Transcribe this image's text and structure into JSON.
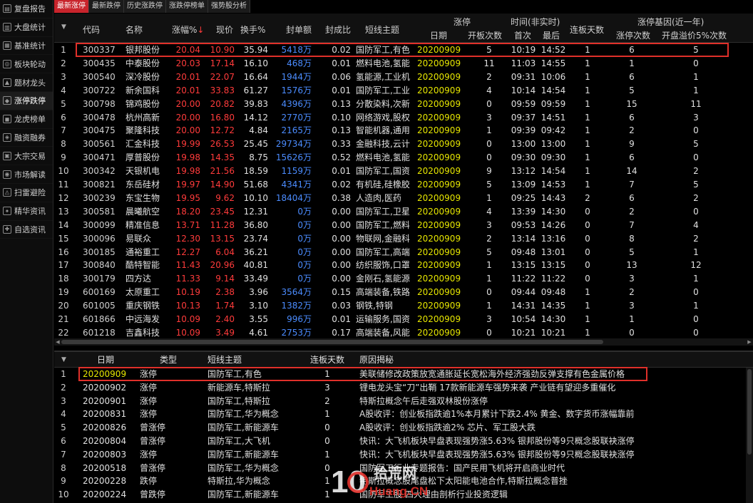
{
  "sidebar": {
    "items": [
      {
        "label": "复盘报告",
        "icon": "report-icon"
      },
      {
        "label": "大盘统计",
        "icon": "market-icon"
      },
      {
        "label": "基准统计",
        "icon": "stats-icon"
      },
      {
        "label": "板块轮动",
        "icon": "rotate-icon"
      },
      {
        "label": "题材龙头",
        "icon": "dragon-icon"
      },
      {
        "label": "涨停跌停",
        "icon": "limit-icon"
      },
      {
        "label": "龙虎榜单",
        "icon": "list-icon"
      },
      {
        "label": "融资融券",
        "icon": "finance-icon"
      },
      {
        "label": "大宗交易",
        "icon": "block-trade-icon"
      },
      {
        "label": "市场解读",
        "icon": "read-icon"
      },
      {
        "label": "扫雷避险",
        "icon": "mine-icon"
      },
      {
        "label": "精华资讯",
        "icon": "news-icon"
      },
      {
        "label": "自选资讯",
        "icon": "star-icon"
      }
    ],
    "active_index": 5
  },
  "tabs": [
    {
      "label": "最新涨停",
      "active": true
    },
    {
      "label": "最新跌停",
      "active": false
    },
    {
      "label": "历史涨跌停",
      "active": false
    },
    {
      "label": "涨跌停榜单",
      "active": false
    },
    {
      "label": "强势股分析",
      "active": false
    }
  ],
  "main_header": {
    "code": "代码",
    "name": "名称",
    "pct": "涨幅%",
    "price": "现价",
    "turnover": "换手%",
    "seal": "封单额",
    "seal_ratio": "封成比",
    "theme": "短线主题",
    "limit_group": "涨停",
    "date": "日期",
    "open_count": "开板次数",
    "time_group": "时间(非实时)",
    "first": "首次",
    "last": "最后",
    "streak": "连板天数",
    "gene_group": "涨停基因(近一年)",
    "zt_count": "涨停次数",
    "premium_count": "开盘溢价5%次数"
  },
  "main_rows": [
    {
      "no": "1",
      "code": "300337",
      "name": "银邦股份",
      "pct": "20.04",
      "price": "10.90",
      "turn": "35.94",
      "seal": "5418万",
      "ratio": "0.02",
      "theme": "国防军工,有色",
      "date": "20200909",
      "open": "5",
      "first": "10:19",
      "last": "14:52",
      "streak": "1",
      "zt": "6",
      "prem": "5"
    },
    {
      "no": "2",
      "code": "300435",
      "name": "中泰股份",
      "pct": "20.03",
      "price": "17.14",
      "turn": "16.10",
      "seal": "468万",
      "ratio": "0.01",
      "theme": "燃料电池,氢能",
      "date": "20200909",
      "open": "11",
      "first": "11:03",
      "last": "14:55",
      "streak": "1",
      "zt": "1",
      "prem": "0"
    },
    {
      "no": "3",
      "code": "300540",
      "name": "深冷股份",
      "pct": "20.01",
      "price": "22.07",
      "turn": "16.64",
      "seal": "1944万",
      "ratio": "0.06",
      "theme": "氢能源,工业机",
      "date": "20200909",
      "open": "2",
      "first": "09:31",
      "last": "10:06",
      "streak": "1",
      "zt": "6",
      "prem": "1"
    },
    {
      "no": "4",
      "code": "300722",
      "name": "新余国科",
      "pct": "20.01",
      "price": "33.83",
      "turn": "61.27",
      "seal": "1576万",
      "ratio": "0.01",
      "theme": "国防军工,工业",
      "date": "20200909",
      "open": "4",
      "first": "10:14",
      "last": "14:54",
      "streak": "1",
      "zt": "5",
      "prem": "1"
    },
    {
      "no": "5",
      "code": "300798",
      "name": "锦鸡股份",
      "pct": "20.00",
      "price": "20.82",
      "turn": "39.83",
      "seal": "4396万",
      "ratio": "0.13",
      "theme": "分散染料,次新",
      "date": "20200909",
      "open": "0",
      "first": "09:59",
      "last": "09:59",
      "streak": "1",
      "zt": "15",
      "prem": "11"
    },
    {
      "no": "6",
      "code": "300478",
      "name": "杭州高新",
      "pct": "20.00",
      "price": "16.80",
      "turn": "14.12",
      "seal": "2770万",
      "ratio": "0.10",
      "theme": "网络游戏,股权",
      "date": "20200909",
      "open": "3",
      "first": "09:37",
      "last": "14:51",
      "streak": "1",
      "zt": "6",
      "prem": "3"
    },
    {
      "no": "7",
      "code": "300475",
      "name": "聚隆科技",
      "pct": "20.00",
      "price": "12.72",
      "turn": "4.84",
      "seal": "2165万",
      "ratio": "0.13",
      "theme": "智能机器,通用",
      "date": "20200909",
      "open": "1",
      "first": "09:39",
      "last": "09:42",
      "streak": "1",
      "zt": "2",
      "prem": "0"
    },
    {
      "no": "8",
      "code": "300561",
      "name": "汇金科技",
      "pct": "19.99",
      "price": "26.53",
      "turn": "25.45",
      "seal": "29734万",
      "ratio": "0.33",
      "theme": "金融科技,云计",
      "date": "20200909",
      "open": "0",
      "first": "13:00",
      "last": "13:00",
      "streak": "1",
      "zt": "9",
      "prem": "5"
    },
    {
      "no": "9",
      "code": "300471",
      "name": "厚普股份",
      "pct": "19.98",
      "price": "14.35",
      "turn": "8.75",
      "seal": "15626万",
      "ratio": "0.52",
      "theme": "燃料电池,氢能",
      "date": "20200909",
      "open": "0",
      "first": "09:30",
      "last": "09:30",
      "streak": "1",
      "zt": "6",
      "prem": "0"
    },
    {
      "no": "10",
      "code": "300342",
      "name": "天银机电",
      "pct": "19.98",
      "price": "21.56",
      "turn": "18.59",
      "seal": "1159万",
      "ratio": "0.01",
      "theme": "国防军工,国资",
      "date": "20200909",
      "open": "9",
      "first": "13:12",
      "last": "14:54",
      "streak": "1",
      "zt": "14",
      "prem": "2"
    },
    {
      "no": "11",
      "code": "300821",
      "name": "东岳硅材",
      "pct": "19.97",
      "price": "14.90",
      "turn": "51.68",
      "seal": "4341万",
      "ratio": "0.02",
      "theme": "有机硅,硅橡胶",
      "date": "20200909",
      "open": "5",
      "first": "13:09",
      "last": "14:53",
      "streak": "1",
      "zt": "7",
      "prem": "5"
    },
    {
      "no": "12",
      "code": "300239",
      "name": "东宝生物",
      "pct": "19.95",
      "price": "9.62",
      "turn": "10.10",
      "seal": "18404万",
      "ratio": "0.38",
      "theme": "人造肉,医药",
      "date": "20200909",
      "open": "1",
      "first": "09:25",
      "last": "14:43",
      "streak": "2",
      "zt": "6",
      "prem": "2"
    },
    {
      "no": "13",
      "code": "300581",
      "name": "晨曦航空",
      "pct": "18.20",
      "price": "23.45",
      "turn": "12.31",
      "seal": "0万",
      "ratio": "0.00",
      "theme": "国防军工,卫星",
      "date": "20200909",
      "open": "4",
      "first": "13:39",
      "last": "14:30",
      "streak": "0",
      "zt": "2",
      "prem": "0"
    },
    {
      "no": "14",
      "code": "300099",
      "name": "精准信息",
      "pct": "13.71",
      "price": "11.28",
      "turn": "36.80",
      "seal": "0万",
      "ratio": "0.00",
      "theme": "国防军工,燃料",
      "date": "20200909",
      "open": "3",
      "first": "09:53",
      "last": "14:26",
      "streak": "0",
      "zt": "7",
      "prem": "4"
    },
    {
      "no": "15",
      "code": "300096",
      "name": "易联众",
      "pct": "12.30",
      "price": "13.15",
      "turn": "23.74",
      "seal": "0万",
      "ratio": "0.00",
      "theme": "物联网,金融科",
      "date": "20200909",
      "open": "2",
      "first": "13:14",
      "last": "13:16",
      "streak": "0",
      "zt": "8",
      "prem": "2"
    },
    {
      "no": "16",
      "code": "300185",
      "name": "通裕重工",
      "pct": "12.27",
      "price": "6.04",
      "turn": "36.21",
      "seal": "0万",
      "ratio": "0.00",
      "theme": "国防军工,高端",
      "date": "20200909",
      "open": "5",
      "first": "09:48",
      "last": "13:01",
      "streak": "0",
      "zt": "5",
      "prem": "1"
    },
    {
      "no": "17",
      "code": "300840",
      "name": "酷特智能",
      "pct": "11.43",
      "price": "20.96",
      "turn": "40.81",
      "seal": "0万",
      "ratio": "0.00",
      "theme": "纺织服饰,口罩",
      "date": "20200909",
      "open": "1",
      "first": "13:15",
      "last": "13:15",
      "streak": "0",
      "zt": "13",
      "prem": "12"
    },
    {
      "no": "18",
      "code": "300179",
      "name": "四方达",
      "pct": "11.33",
      "price": "9.14",
      "turn": "33.49",
      "seal": "0万",
      "ratio": "0.00",
      "theme": "金刚石,氢能源",
      "date": "20200909",
      "open": "1",
      "first": "11:22",
      "last": "11:22",
      "streak": "0",
      "zt": "3",
      "prem": "1"
    },
    {
      "no": "19",
      "code": "600169",
      "name": "太原重工",
      "pct": "10.19",
      "price": "2.38",
      "turn": "3.96",
      "seal": "3564万",
      "ratio": "0.15",
      "theme": "高端装备,铁路",
      "date": "20200909",
      "open": "0",
      "first": "09:44",
      "last": "09:48",
      "streak": "1",
      "zt": "2",
      "prem": "0"
    },
    {
      "no": "20",
      "code": "601005",
      "name": "重庆钢铁",
      "pct": "10.13",
      "price": "1.74",
      "turn": "3.10",
      "seal": "1382万",
      "ratio": "0.03",
      "theme": "钢铁,特钢",
      "date": "20200909",
      "open": "1",
      "first": "14:31",
      "last": "14:35",
      "streak": "1",
      "zt": "3",
      "prem": "1"
    },
    {
      "no": "21",
      "code": "601866",
      "name": "中远海发",
      "pct": "10.09",
      "price": "2.40",
      "turn": "3.55",
      "seal": "996万",
      "ratio": "0.01",
      "theme": "运输服务,国资",
      "date": "20200909",
      "open": "3",
      "first": "10:54",
      "last": "14:30",
      "streak": "1",
      "zt": "1",
      "prem": "0"
    },
    {
      "no": "22",
      "code": "601218",
      "name": "吉鑫科技",
      "pct": "10.09",
      "price": "3.49",
      "turn": "4.61",
      "seal": "2753万",
      "ratio": "0.17",
      "theme": "高端装备,风能",
      "date": "20200909",
      "open": "0",
      "first": "10:21",
      "last": "10:21",
      "streak": "1",
      "zt": "0",
      "prem": "0"
    }
  ],
  "bottom_header": {
    "date": "日期",
    "type": "类型",
    "theme": "短线主题",
    "streak": "连板天数",
    "reason": "原因揭秘"
  },
  "bottom_rows": [
    {
      "no": "1",
      "date": "20200909",
      "type": "涨停",
      "theme": "国防军工,有色",
      "streak": "1",
      "reason": "美联储修改政策放宽通胀延长宽松海外经济强劲反弹支撑有色金属价格"
    },
    {
      "no": "2",
      "date": "20200902",
      "type": "涨停",
      "theme": "新能源车,特斯拉",
      "streak": "3",
      "reason": "锂电龙头宝“刀”出鞘 17款新能源车强势来袭 产业链有望迎多重催化"
    },
    {
      "no": "3",
      "date": "20200901",
      "type": "涨停",
      "theme": "国防军工,特斯拉",
      "streak": "2",
      "reason": "特斯拉概念午后走强双林股份涨停"
    },
    {
      "no": "4",
      "date": "20200831",
      "type": "涨停",
      "theme": "国防军工,华为概念",
      "streak": "1",
      "reason": "A股收评：创业板指跌逾1%本月累计下跌2.4% 黄金、数字货币涨幅靠前"
    },
    {
      "no": "5",
      "date": "20200826",
      "type": "曾涨停",
      "theme": "国防军工,新能源车",
      "streak": "0",
      "reason": "A股收评：创业板指跌逾2% 芯片、军工股大跌"
    },
    {
      "no": "6",
      "date": "20200804",
      "type": "曾涨停",
      "theme": "国防军工,大飞机",
      "streak": "0",
      "reason": "快讯：大飞机板块早盘表现强势涨5.63% 银邦股份等9只概念股联袂涨停"
    },
    {
      "no": "7",
      "date": "20200803",
      "type": "涨停",
      "theme": "国防军工,新能源车",
      "streak": "1",
      "reason": "快讯：大飞机板块早盘表现强势涨5.63% 银邦股份等9只概念股联袂涨停"
    },
    {
      "no": "8",
      "date": "20200518",
      "type": "曾涨停",
      "theme": "国防军工,华为概念",
      "streak": "0",
      "reason": "国防军工行业专题报告：国产民用飞机将开启商业时代"
    },
    {
      "no": "9",
      "date": "20200228",
      "type": "跌停",
      "theme": "特斯拉,华为概念",
      "streak": "1",
      "reason": "特斯拉概念股尾盘松下太阳能电池合作,特斯拉概念普挫"
    },
    {
      "no": "10",
      "date": "20200224",
      "type": "曾跌停",
      "theme": "国防军工,新能源车",
      "streak": "1",
      "reason": "国防军工股 四大理由剖析行业投资逻辑"
    }
  ],
  "watermark": {
    "number": "10",
    "brand": "拾荒网",
    "domain": "Huang.CN"
  },
  "colors": {
    "up": "#ff3b3b",
    "seal": "#4b8cff",
    "date": "#e6e600",
    "highlight": "#e0302a",
    "active_tab": "#c8242c"
  }
}
